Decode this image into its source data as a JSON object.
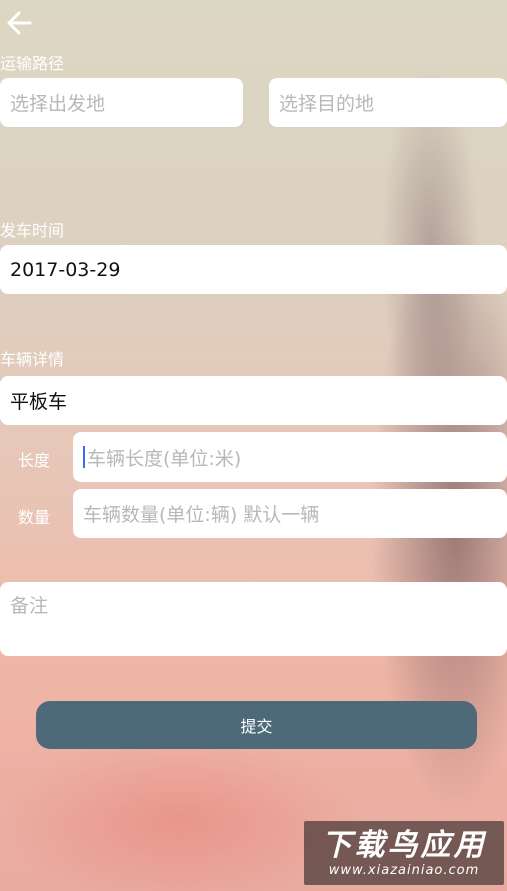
{
  "header": {
    "back_icon": "arrow-left-icon"
  },
  "route": {
    "label": "运输路径",
    "origin_placeholder": "选择出发地",
    "destination_placeholder": "选择目的地"
  },
  "departure": {
    "label": "发车时间",
    "date_value": "2017-03-29"
  },
  "vehicle": {
    "label": "车辆详情",
    "type_value": "平板车",
    "length_label": "长度",
    "length_placeholder": "车辆长度(单位:米)",
    "quantity_label": "数量",
    "quantity_placeholder": "车辆数量(单位:辆) 默认一辆"
  },
  "remarks": {
    "placeholder": "备注"
  },
  "submit_label": "提交",
  "watermark": {
    "title": "下载鸟应用",
    "url": "www.xiazainiao.com"
  },
  "colors": {
    "submit_bg": "#4e6a79",
    "cursor": "#3b6cf0",
    "placeholder": "#b8b8b8"
  }
}
